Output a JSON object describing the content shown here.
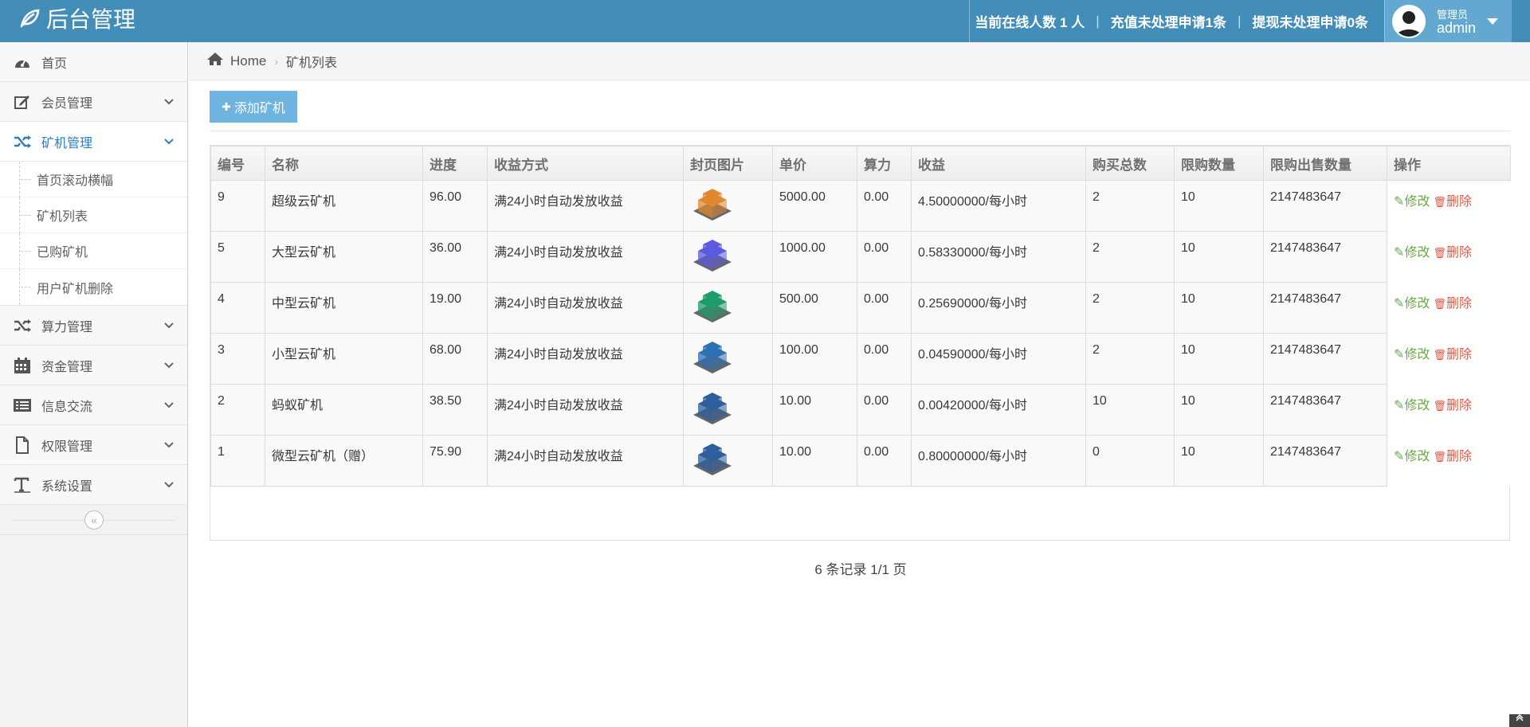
{
  "app": {
    "title": "后台管理",
    "online_text": "当前在线人数 1 人",
    "recharge_text": "充值未处理申请1条",
    "withdraw_text": "提现未处理申请0条",
    "user_role": "管理员",
    "user_name": "admin"
  },
  "sidebar": {
    "items": [
      {
        "label": "首页"
      },
      {
        "label": "会员管理"
      },
      {
        "label": "矿机管理"
      },
      {
        "label": "算力管理"
      },
      {
        "label": "资金管理"
      },
      {
        "label": "信息交流"
      },
      {
        "label": "权限管理"
      },
      {
        "label": "系统设置"
      }
    ],
    "submenu": [
      {
        "label": "首页滚动横幅"
      },
      {
        "label": "矿机列表"
      },
      {
        "label": "已购矿机"
      },
      {
        "label": "用户矿机删除"
      }
    ],
    "collapse_glyph": "«"
  },
  "breadcrumb": {
    "home": "Home",
    "separator": "›",
    "current": "矿机列表"
  },
  "toolbar": {
    "add_label": "添加矿机",
    "add_glyph": "✚"
  },
  "table": {
    "headers": [
      "编号",
      "名称",
      "进度",
      "收益方式",
      "封页图片",
      "单价",
      "算力",
      "收益",
      "购买总数",
      "限购数量",
      "限购出售数量",
      "操作"
    ],
    "rows": [
      {
        "id": "9",
        "name": "超级云矿机",
        "progress": "96.00",
        "method": "满24小时自动发放收益",
        "image_color": "#e0882e",
        "price": "5000.00",
        "power": "0.00",
        "income": "4.50000000/每小时",
        "total": "2",
        "limit": "10",
        "sell_limit": "2147483647"
      },
      {
        "id": "5",
        "name": "大型云矿机",
        "progress": "36.00",
        "method": "满24小时自动发放收益",
        "image_color": "#5b5be0",
        "price": "1000.00",
        "power": "0.00",
        "income": "0.58330000/每小时",
        "total": "2",
        "limit": "10",
        "sell_limit": "2147483647"
      },
      {
        "id": "4",
        "name": "中型云矿机",
        "progress": "19.00",
        "method": "满24小时自动发放收益",
        "image_color": "#1e9c6a",
        "price": "500.00",
        "power": "0.00",
        "income": "0.25690000/每小时",
        "total": "2",
        "limit": "10",
        "sell_limit": "2147483647"
      },
      {
        "id": "3",
        "name": "小型云矿机",
        "progress": "68.00",
        "method": "满24小时自动发放收益",
        "image_color": "#2f6fb3",
        "price": "100.00",
        "power": "0.00",
        "income": "0.04590000/每小时",
        "total": "2",
        "limit": "10",
        "sell_limit": "2147483647"
      },
      {
        "id": "2",
        "name": "蚂蚁矿机",
        "progress": "38.50",
        "method": "满24小时自动发放收益",
        "image_color": "#2d5f9e",
        "price": "10.00",
        "power": "0.00",
        "income": "0.00420000/每小时",
        "total": "10",
        "limit": "10",
        "sell_limit": "2147483647"
      },
      {
        "id": "1",
        "name": "微型云矿机（赠）",
        "progress": "75.90",
        "method": "满24小时自动发放收益",
        "image_color": "#2d5f9e",
        "price": "10.00",
        "power": "0.00",
        "income": "0.80000000/每小时",
        "total": "0",
        "limit": "10",
        "sell_limit": "2147483647"
      }
    ],
    "edit_label": "修改",
    "delete_label": "删除",
    "summary": "6 条记录 1/1 页"
  },
  "colors": {
    "navbar": "#438eb9",
    "accent": "#2b7dbc",
    "edit": "#69aa46",
    "delete": "#dd5a43"
  }
}
